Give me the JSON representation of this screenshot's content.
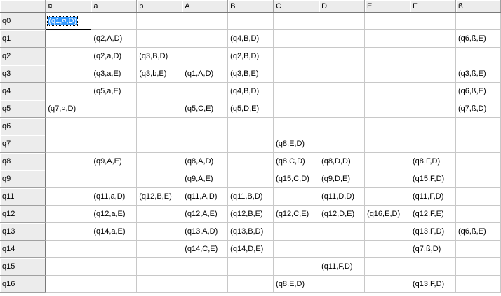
{
  "columns": [
    "¤",
    "a",
    "b",
    "A",
    "B",
    "C",
    "D",
    "E",
    "F",
    "ß"
  ],
  "selected": {
    "row": 0,
    "col": 0
  },
  "rows": [
    {
      "label": "q0",
      "cells": [
        "(q1,¤,D)",
        "",
        "",
        "",
        "",
        "",
        "",
        "",
        "",
        ""
      ]
    },
    {
      "label": "q1",
      "cells": [
        "",
        "(q2,A,D)",
        "",
        "",
        "(q4,B,D)",
        "",
        "",
        "",
        "",
        "(q6,ß,E)"
      ]
    },
    {
      "label": "q2",
      "cells": [
        "",
        "(q2,a,D)",
        "(q3,B,D)",
        "",
        "(q2,B,D)",
        "",
        "",
        "",
        "",
        ""
      ]
    },
    {
      "label": "q3",
      "cells": [
        "",
        "(q3,a,E)",
        "(q3,b,E)",
        "(q1,A,D)",
        "(q3,B,E)",
        "",
        "",
        "",
        "",
        "(q3,ß,E)"
      ]
    },
    {
      "label": "q4",
      "cells": [
        "",
        "(q5,a,E)",
        "",
        "",
        "(q4,B,D)",
        "",
        "",
        "",
        "",
        "(q6,ß,E)"
      ]
    },
    {
      "label": "q5",
      "cells": [
        "(q7,¤,D)",
        "",
        "",
        "(q5,C,E)",
        "(q5,D,E)",
        "",
        "",
        "",
        "",
        "(q7,ß,D)"
      ]
    },
    {
      "label": "q6",
      "cells": [
        "",
        "",
        "",
        "",
        "",
        "",
        "",
        "",
        "",
        ""
      ]
    },
    {
      "label": "q7",
      "cells": [
        "",
        "",
        "",
        "",
        "",
        "(q8,E,D)",
        "",
        "",
        "",
        ""
      ]
    },
    {
      "label": "q8",
      "cells": [
        "",
        "(q9,A,E)",
        "",
        "(q8,A,D)",
        "",
        "(q8,C,D)",
        "(q8,D,D)",
        "",
        "(q8,F,D)",
        ""
      ]
    },
    {
      "label": "q9",
      "cells": [
        "",
        "",
        "",
        "(q9,A,E)",
        "",
        "(q15,C,D)",
        "(q9,D,E)",
        "",
        "(q15,F,D)",
        ""
      ]
    },
    {
      "label": "q11",
      "cells": [
        "",
        "(q11,a,D)",
        "(q12,B,E)",
        "(q11,A,D)",
        "(q11,B,D)",
        "",
        "(q11,D,D)",
        "",
        "(q11,F,D)",
        ""
      ]
    },
    {
      "label": "q12",
      "cells": [
        "",
        "(q12,a,E)",
        "",
        "(q12,A,E)",
        "(q12,B,E)",
        "(q12,C,E)",
        "(q12,D,E)",
        "(q16,E,D)",
        "(q12,F,E)",
        ""
      ]
    },
    {
      "label": "q13",
      "cells": [
        "",
        "(q14,a,E)",
        "",
        "(q13,A,D)",
        "(q13,B,D)",
        "",
        "",
        "",
        "(q13,F,D)",
        "(q6,ß,E)"
      ]
    },
    {
      "label": "q14",
      "cells": [
        "",
        "",
        "",
        "(q14,C,E)",
        "(q14,D,E)",
        "",
        "",
        "",
        "(q7,ß,D)",
        ""
      ]
    },
    {
      "label": "q15",
      "cells": [
        "",
        "",
        "",
        "",
        "",
        "",
        "(q11,F,D)",
        "",
        "",
        ""
      ]
    },
    {
      "label": "q16",
      "cells": [
        "",
        "",
        "",
        "",
        "",
        "(q8,E,D)",
        "",
        "",
        "(q13,F,D)",
        ""
      ]
    }
  ]
}
